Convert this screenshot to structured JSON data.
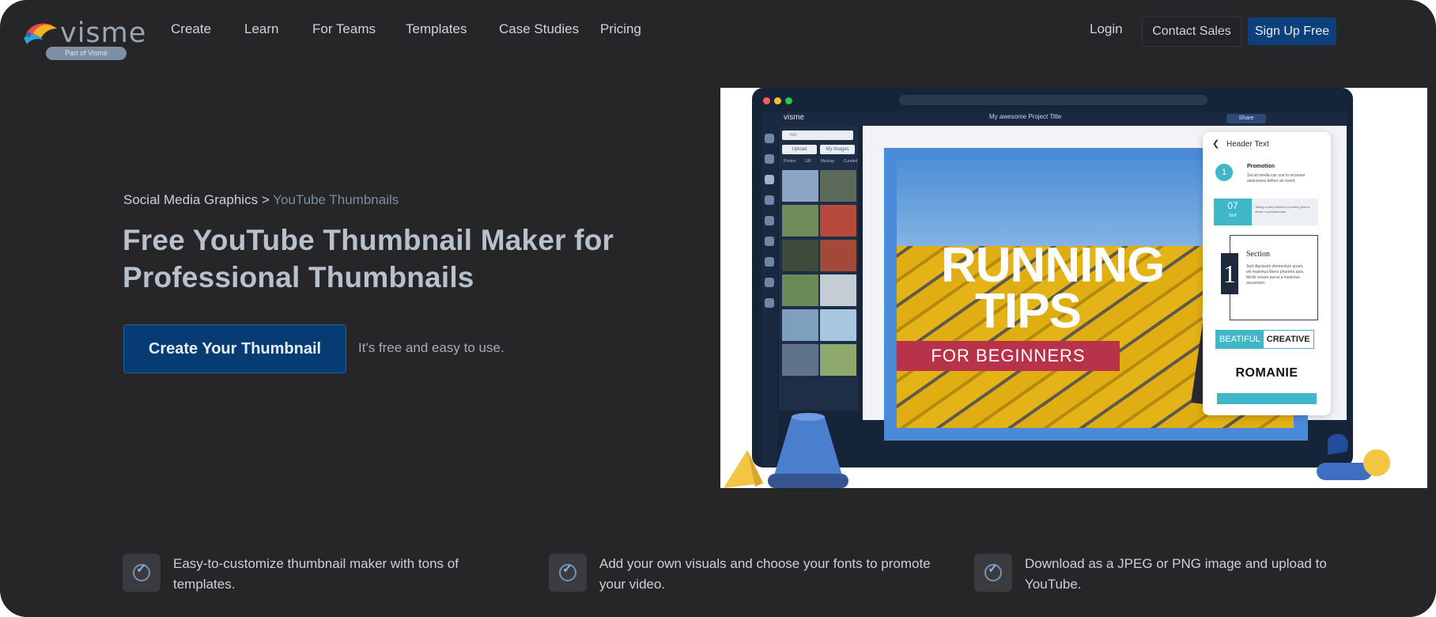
{
  "nav": {
    "logo_text": "visme",
    "logo_badge": "Part of Visme",
    "menu": [
      "Create",
      "Learn",
      "For Teams",
      "Templates",
      "Case Studies",
      "Pricing"
    ],
    "login": "Login",
    "contact_sales": "Contact Sales",
    "sign_up": "Sign Up Free"
  },
  "hero": {
    "breadcrumb_parent": "Social Media Graphics",
    "breadcrumb_sep": ">",
    "breadcrumb_current": "YouTube Thumbnails",
    "title": "Free YouTube Thumbnail Maker for Professional Thumbnails",
    "cta_label": "Create Your Thumbnail",
    "cta_note": "It's free and easy to use."
  },
  "mockup": {
    "app_logo": "visme",
    "project_title": "My awesome Project Title",
    "share_label": "Share",
    "search_text": "run",
    "upload_label": "Upload",
    "my_images_label": "My Images",
    "panel_tabs": [
      "Photos",
      "GIF",
      "Mockup",
      "Curated"
    ],
    "thumb_title_line1": "RUNNING",
    "thumb_title_line2": "TIPS",
    "thumb_subtitle": "FOR BEGINNERS",
    "right_panel": {
      "header": "Header Text",
      "step_number": "1",
      "promo_title": "Promotion",
      "promo_text": "Social media can use to increase awareness before an event.",
      "date_day": "07",
      "date_month": "SEP",
      "date_text": "Telling a story behind a product gives a sense of genuineness.",
      "section_title": "Section",
      "section_number": "1",
      "section_text": "Sed dignissim elementum quam, vel maximus libero pharetra quis. Morbi ornare purus a maximus accumsan.",
      "beautiful": "BEATIFUL",
      "creative": "CREATIVE",
      "romanie": "ROMANIE"
    }
  },
  "features": [
    {
      "text": "Easy-to-customize thumbnail maker with tons of templates."
    },
    {
      "text": "Add your own visuals and choose your fonts to promote your video."
    },
    {
      "text": "Download as a JPEG or PNG image and upload to YouTube."
    }
  ],
  "colors": {
    "background": "#262629",
    "primary_button": "#073b74",
    "accent_teal": "#3fb7c9",
    "banner_red": "#b8334a"
  }
}
